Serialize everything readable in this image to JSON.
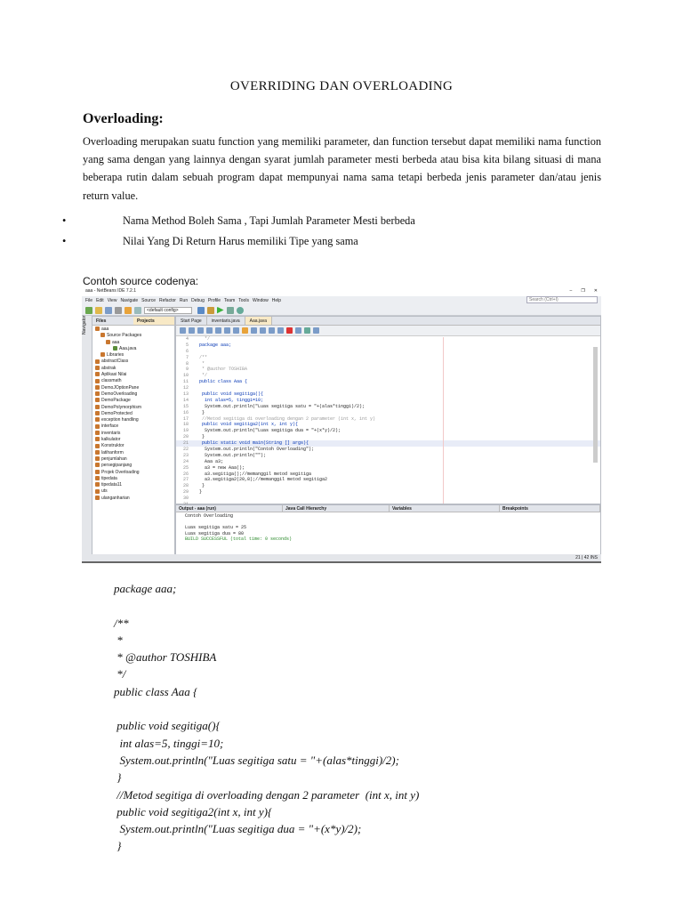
{
  "title": "OVERRIDING DAN OVERLOADING",
  "heading": "Overloading:",
  "paragraph": "Overloading merupakan suatu function yang memiliki parameter, dan function tersebut dapat memiliki nama function yang sama dengan yang lainnya dengan syarat jumlah parameter mesti berbeda atau bisa kita bilang situasi di mana beberapa rutin dalam sebuah program dapat mempunyai nama sama tetapi berbeda jenis parameter dan/atau jenis return value.",
  "bullets": [
    "Nama Method Boleh Sama , Tapi Jumlah Parameter Mesti berbeda",
    "Nilai Yang Di Return Harus memiliki Tipe yang sama"
  ],
  "bullet_symbol": "•",
  "example_label": "Contoh source codenya:",
  "ide": {
    "window_title": "aaa - NetBeans IDE 7.2.1",
    "window_controls": [
      "–",
      "❐",
      "✕"
    ],
    "menu": [
      "File",
      "Edit",
      "View",
      "Navigate",
      "Source",
      "Refactor",
      "Run",
      "Debug",
      "Profile",
      "Team",
      "Tools",
      "Window",
      "Help"
    ],
    "config": "<default config>",
    "search_placeholder": "Search (Ctrl+I)",
    "navigator_label": "Navigator",
    "panel_tabs": [
      "Files",
      "Projects"
    ],
    "tree": [
      "aaa",
      "Source Packages",
      "aaa",
      "Aaa.java",
      "Libraries",
      "abstractClass",
      "abstrak",
      "Aplikasi Nilai",
      "classmath",
      "DemoJOptionPane",
      "DemoOverloading",
      "DemoPackage",
      "DemoPolymorphism",
      "DemoProtected",
      "exception handling",
      "interface",
      "inventaris",
      "kalkulator",
      "Konstruktor",
      "latihanform",
      "penjumlahan",
      "persegipanjang",
      "Projek Overloading",
      "tipedata",
      "tipedata11",
      "uts",
      "ulanganharian"
    ],
    "editor_tabs": [
      "Start Page",
      "inventaris.java",
      "Aaa.java"
    ],
    "code_lines": [
      {
        "n": "4",
        "t": "  */"
      },
      {
        "n": "5",
        "t": "package aaa;"
      },
      {
        "n": "6",
        "t": ""
      },
      {
        "n": "7",
        "t": "/**"
      },
      {
        "n": "8",
        "t": " *"
      },
      {
        "n": "9",
        "t": " * @author TOSHIBA"
      },
      {
        "n": "10",
        "t": " */"
      },
      {
        "n": "11",
        "t": "public class Aaa {"
      },
      {
        "n": "12",
        "t": ""
      },
      {
        "n": "13",
        "t": " public void segitiga(){"
      },
      {
        "n": "14",
        "t": "  int alas=5, tinggi=10;"
      },
      {
        "n": "15",
        "t": "  System.out.println(\"Luas segitiga satu = \"+(alas*tinggi)/2);"
      },
      {
        "n": "16",
        "t": " }"
      },
      {
        "n": "17",
        "t": " //Metod segitiga di overloading dengan 2 parameter (int x, int y)"
      },
      {
        "n": "18",
        "t": " public void segitiga2(int x, int y){"
      },
      {
        "n": "19",
        "t": "  System.out.println(\"Luas segitiga dua = \"+(x*y)/2);"
      },
      {
        "n": "20",
        "t": " }"
      },
      {
        "n": "21",
        "t": " public static void main(String [] args){"
      },
      {
        "n": "22",
        "t": "  System.out.println(\"Contoh Overloading\");"
      },
      {
        "n": "23",
        "t": "  System.out.println(\"\");"
      },
      {
        "n": "24",
        "t": "  Aaa a3;"
      },
      {
        "n": "25",
        "t": "  a3 = new Aaa();"
      },
      {
        "n": "26",
        "t": "  a3.segitiga();//memanggil metod segitiga"
      },
      {
        "n": "27",
        "t": "  a3.segitiga2(20,8);//memanggil metod segitiga2"
      },
      {
        "n": "28",
        "t": " }"
      },
      {
        "n": "29",
        "t": "}"
      },
      {
        "n": "30",
        "t": ""
      },
      {
        "n": "31",
        "t": ""
      }
    ],
    "output_tabs": [
      "Output - aaa (run)",
      "Java Call Hierarchy",
      "Variables",
      "Breakpoints"
    ],
    "output_lines": [
      "Contoh Overloading",
      "",
      "Luas segitiga satu = 25",
      "Luas segitiga dua = 80",
      "BUILD SUCCESSFUL (total time: 0 seconds)"
    ],
    "status": "21 | 42     INS"
  },
  "code_text": [
    "package aaa;",
    "",
    "/**",
    " *",
    " * @author TOSHIBA",
    " */",
    "public class Aaa {",
    "",
    " public void segitiga(){",
    "  int alas=5, tinggi=10;",
    "  System.out.println(\"Luas segitiga satu = \"+(alas*tinggi)/2);",
    " }",
    " //Metod segitiga di overloading dengan 2 parameter  (int x, int y)",
    " public void segitiga2(int x, int y){",
    "  System.out.println(\"Luas segitiga dua = \"+(x*y)/2);",
    " }"
  ]
}
